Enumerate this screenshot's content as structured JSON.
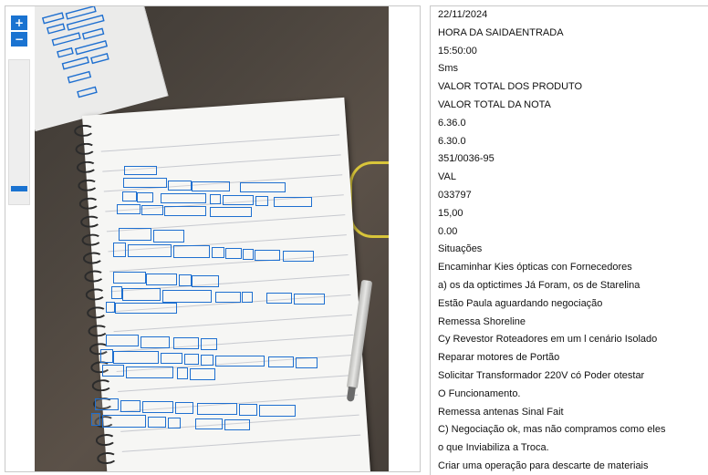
{
  "viewer": {
    "zoom_in_label": "+",
    "zoom_out_label": "−",
    "zoom_level": 0.92,
    "box_color": "#1e6fd0"
  },
  "lines": [
    "22/11/2024",
    "HORA DA SAIDAENTRADA",
    "15:50:00",
    "Sms",
    "VALOR TOTAL DOS PRODUTO",
    "VALOR TOTAL DA NOTA",
    "6.36.0",
    "6.30.0",
    "351/0036-95",
    "VAL",
    "033797",
    "15,00",
    "0.00",
    "Situações",
    "Encaminhar Kies ópticas con Fornecedores",
    "a) os da optictimes Já Foram, os de Starelina",
    "Estão Paula aguardando negociação",
    "Remessa Shoreline",
    "Cy Revestor Roteadores em um l cenário Isolado",
    "Reparar motores de Portão",
    "Solicitar Transformador 220V có Poder otestar",
    "O Funcionamento.",
    "Remessa antenas Sinal Fait",
    "C) Negociação ok, mas não compramos como eles",
    "o que Inviabiliza a Troca.",
    "Criar uma operação para descarte de materiais"
  ]
}
